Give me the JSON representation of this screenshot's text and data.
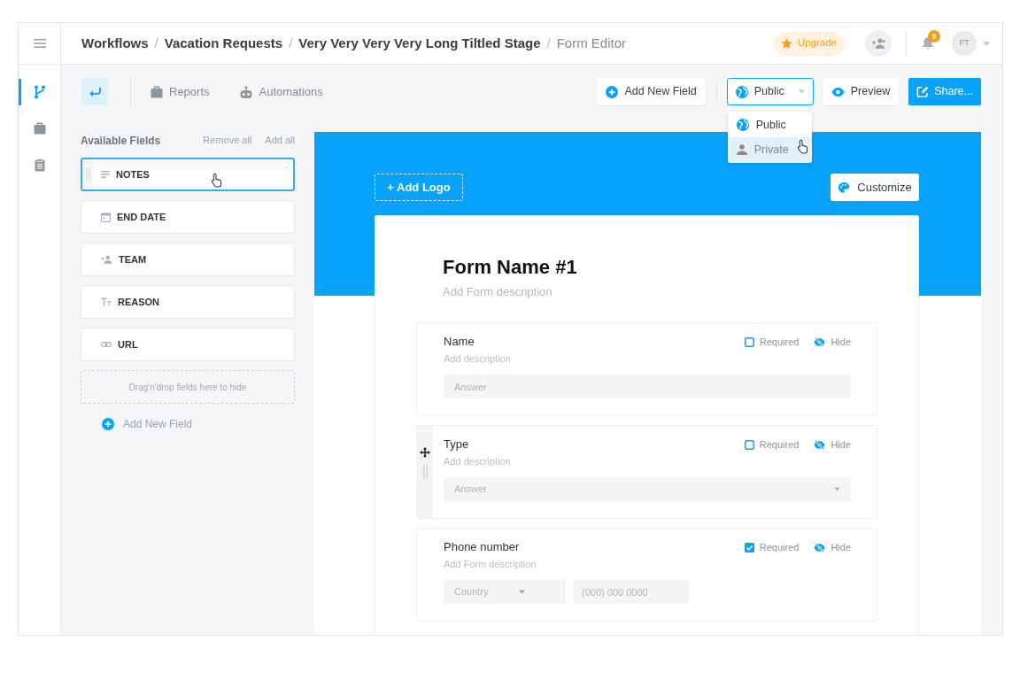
{
  "sidebar": {
    "items": [
      {
        "kind": "branch",
        "selected": true
      },
      {
        "kind": "briefcase",
        "selected": false
      },
      {
        "kind": "clipboard",
        "selected": false
      }
    ]
  },
  "breadcrumbs": [
    {
      "label": "Workflows",
      "current": false
    },
    {
      "separator": "/",
      "label": "Vacation Requests",
      "current": false
    },
    {
      "separator": "/",
      "label": "Very Very Very Very Long Tiltled Stage",
      "current": false
    },
    {
      "separator": "/",
      "label": "Form Editor",
      "current": true
    }
  ],
  "header": {
    "upgrade": "Upgrade",
    "notifications": "9",
    "avatar": "PT"
  },
  "toolbar": {
    "links": [
      {
        "label": "Reports",
        "kind": "briefcase"
      },
      {
        "label": "Automations",
        "kind": "robot"
      }
    ],
    "add_field": "Add New Field",
    "visibility": {
      "value": "Public",
      "expanded": true,
      "options": [
        {
          "label": "Public",
          "kind": "globe",
          "selected": true,
          "hovered": false
        },
        {
          "label": "Private",
          "kind": "person",
          "selected": false,
          "hovered": true
        }
      ]
    },
    "preview": "Preview",
    "share": "Share..."
  },
  "available_fields": {
    "title": "Available Fields",
    "remove_all": "Remove all",
    "add_all": "Add all",
    "fields": [
      {
        "label": "NOTES",
        "kind": "notes",
        "hovered": true
      },
      {
        "label": "END DATE",
        "kind": "date",
        "hovered": false
      },
      {
        "label": "TEAM",
        "kind": "team",
        "hovered": false
      },
      {
        "label": "REASON",
        "kind": "text",
        "hovered": false
      },
      {
        "label": "URL",
        "kind": "link",
        "hovered": false
      }
    ],
    "dropzone": "Drag'n'drop fields here to hide",
    "add_field": "Add New Field"
  },
  "form": {
    "add_logo": "+ Add Logo",
    "customize": "Customize",
    "title": "Form Name #1",
    "description": "Add Form description",
    "fields": [
      {
        "kind": "text",
        "label": "Name",
        "description": "Add description",
        "placeholder": "Answer",
        "required": false,
        "required_label": "Required",
        "hide_label": "Hide",
        "hovered": false
      },
      {
        "kind": "select",
        "label": "Type",
        "description": "Add description",
        "placeholder": "Answer",
        "required": false,
        "required_label": "Required",
        "hide_label": "Hide",
        "hovered": true
      },
      {
        "kind": "phone",
        "label": "Phone number",
        "description": "Add Form description",
        "country_placeholder": "Country",
        "placeholder": "(000) 000 0000",
        "required": true,
        "required_label": "Required",
        "hide_label": "Hide",
        "hovered": false
      }
    ]
  }
}
